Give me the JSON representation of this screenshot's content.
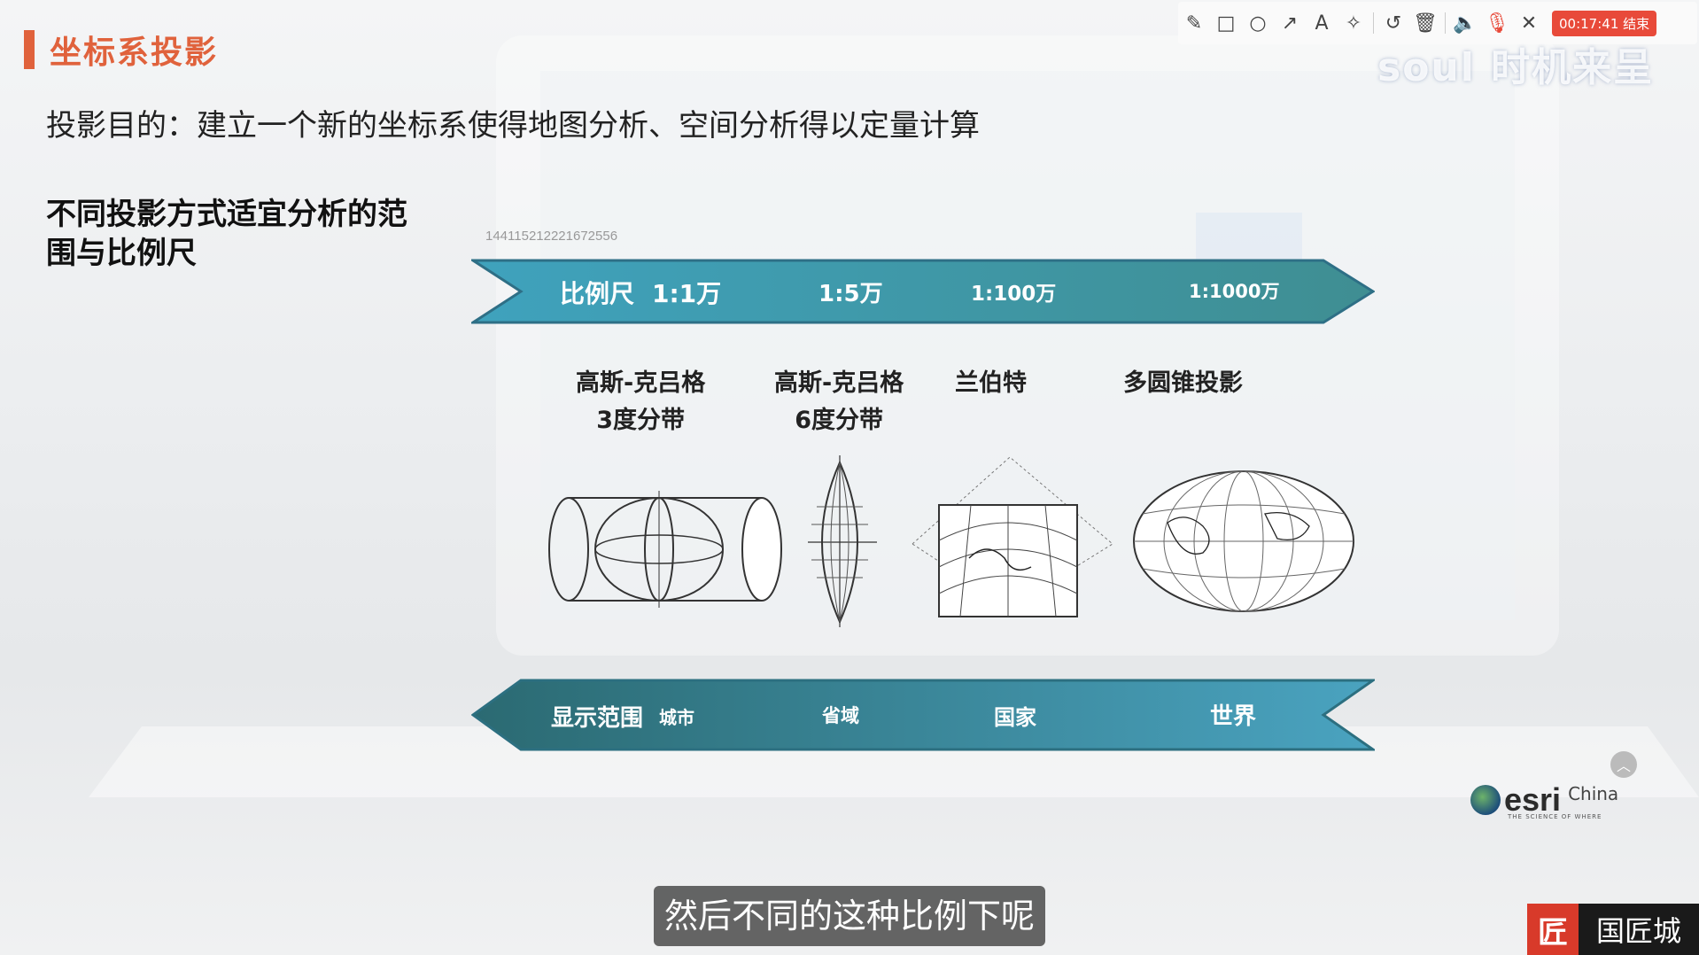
{
  "slide": {
    "title": "坐标系投影",
    "purpose": "投影目的：建立一个新的坐标系使得地图分析、空间分析得以定量计算",
    "subhead": "不同投影方式适宜分析的范围与比例尺",
    "id_number": "144115212221672556"
  },
  "scale_band": {
    "label": "比例尺",
    "values": [
      "1:1万",
      "1:5万",
      "1:100万",
      "1:1000万"
    ],
    "color": "#3f9fb6"
  },
  "projections": [
    {
      "line1": "高斯-克吕格",
      "line2": "3度分带"
    },
    {
      "line1": "高斯-克吕格",
      "line2": "6度分带"
    },
    {
      "line1": "兰伯特",
      "line2": ""
    },
    {
      "line1": "多圆锥投影",
      "line2": ""
    }
  ],
  "extent_band": {
    "label": "显示范围",
    "values": [
      "城市",
      "省域",
      "国家",
      "世界"
    ],
    "color": "#2d7f86"
  },
  "subtitle": "然后不同的这种比例下呢",
  "toolbar": {
    "icons": [
      "pencil-icon",
      "rectangle-icon",
      "circle-icon",
      "arrow-icon",
      "text-icon",
      "magic-wand-icon",
      "undo-icon",
      "trash-icon",
      "volume-icon",
      "mic-muted-icon",
      "close-icon"
    ],
    "timer": "00:17:41 结束"
  },
  "watermark": "soul 时机来呈",
  "esri": {
    "name": "esri",
    "region": "China",
    "tagline": "THE SCIENCE OF WHERE"
  },
  "brand": {
    "logo_char": "匠",
    "name": "国匠城"
  }
}
